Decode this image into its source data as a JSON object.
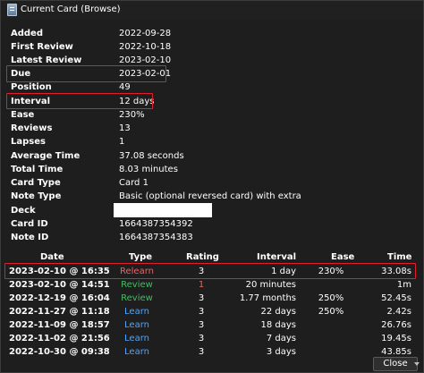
{
  "window": {
    "title": "Current Card (Browse)"
  },
  "colors": {
    "relearn": "#f06262",
    "review": "#3fbf5f",
    "learn": "#4fa6ff",
    "highlight_border": "#e01e2e"
  },
  "card_info": [
    {
      "label": "Added",
      "value": "2022-09-28"
    },
    {
      "label": "First Review",
      "value": "2022-10-18"
    },
    {
      "label": "Latest Review",
      "value": "2023-02-10"
    },
    {
      "label": "Due",
      "value": "2023-02-01"
    },
    {
      "label": "Position",
      "value": "49"
    },
    {
      "label": "Interval",
      "value": "12 days"
    },
    {
      "label": "Ease",
      "value": "230%"
    },
    {
      "label": "Reviews",
      "value": "13"
    },
    {
      "label": "Lapses",
      "value": "1"
    },
    {
      "label": "Average Time",
      "value": "37.08 seconds"
    },
    {
      "label": "Total Time",
      "value": "8.03 minutes"
    },
    {
      "label": "Card Type",
      "value": "Card 1"
    },
    {
      "label": "Note Type",
      "value": "Basic (optional reversed card) with extra"
    },
    {
      "label": "Deck",
      "value": ""
    },
    {
      "label": "Card ID",
      "value": "1664387354392"
    },
    {
      "label": "Note ID",
      "value": "1664387354383"
    }
  ],
  "revlog": {
    "headers": {
      "date": "Date",
      "type": "Type",
      "rating": "Rating",
      "interval": "Interval",
      "ease": "Ease",
      "time": "Time"
    },
    "rows": [
      {
        "date": "2023-02-10 @ 16:35",
        "type": "Relearn",
        "type_color": "relearn",
        "rating": "3",
        "interval": "1 day",
        "ease": "230%",
        "time": "33.08s"
      },
      {
        "date": "2023-02-10 @ 14:51",
        "type": "Review",
        "type_color": "review",
        "rating": "1",
        "interval": "20 minutes",
        "ease": "",
        "time": "1m"
      },
      {
        "date": "2022-12-19 @ 16:04",
        "type": "Review",
        "type_color": "review",
        "rating": "3",
        "interval": "1.77 months",
        "ease": "250%",
        "time": "52.45s"
      },
      {
        "date": "2022-11-27 @ 11:18",
        "type": "Learn",
        "type_color": "learn",
        "rating": "3",
        "interval": "22 days",
        "ease": "250%",
        "time": "2.42s"
      },
      {
        "date": "2022-11-09 @ 18:57",
        "type": "Learn",
        "type_color": "learn",
        "rating": "3",
        "interval": "18 days",
        "ease": "",
        "time": "26.76s"
      },
      {
        "date": "2022-11-02 @ 21:56",
        "type": "Learn",
        "type_color": "learn",
        "rating": "3",
        "interval": "7 days",
        "ease": "",
        "time": "19.45s"
      },
      {
        "date": "2022-10-30 @ 09:38",
        "type": "Learn",
        "type_color": "learn",
        "rating": "3",
        "interval": "3 days",
        "ease": "",
        "time": "43.85s"
      }
    ]
  },
  "buttons": {
    "close_label": "Close"
  },
  "icons": {
    "app": "anki-card-icon",
    "scroll": "chevron-down-icon"
  }
}
